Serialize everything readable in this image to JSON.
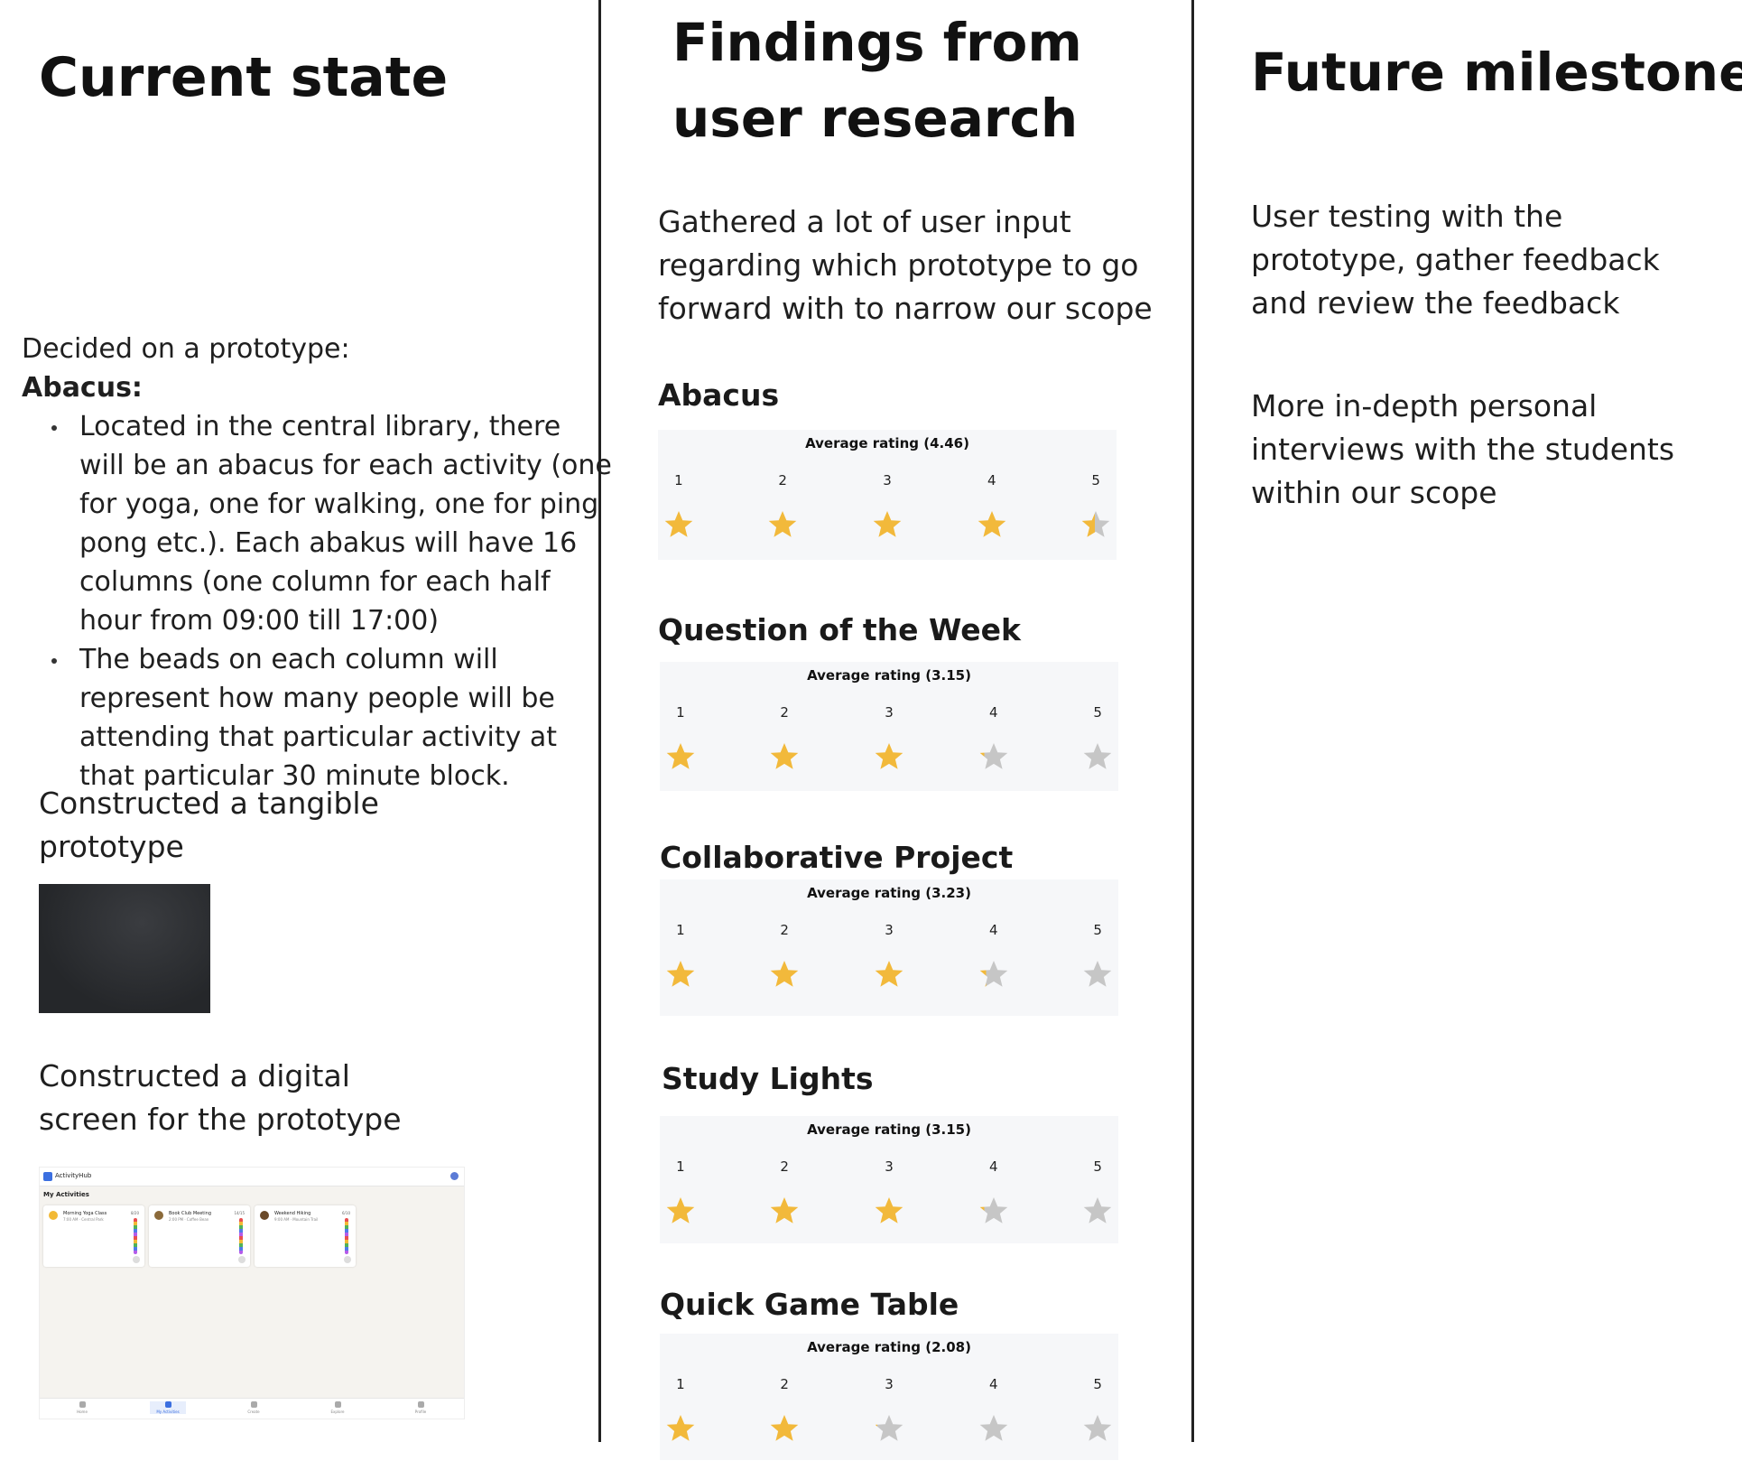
{
  "columns": {
    "current": {
      "title": "Current state",
      "decided": "Decided on a prototype:",
      "abacus_heading": "Abacus:",
      "bullets": [
        "Located in the central library, there will be an abacus for each activity (one for yoga, one for walking, one for ping pong etc.). Each abakus will have 16 columns (one column for each half hour from 09:00 till 17:00)",
        "The beads on each column will represent how many people will be attending that particular activity at that particular 30 minute block."
      ],
      "tangible": "Constructed a tangible prototype",
      "digital": "Constructed a digital screen for the prototype"
    },
    "findings": {
      "title": "Findings from user research",
      "intro": "Gathered a lot of user input regarding which prototype to go forward with to narrow our scope"
    },
    "future": {
      "title": "Future milestones",
      "items": [
        "User testing with the prototype, gather feedback and review the feedback",
        "More in-depth personal interviews with the students within our scope"
      ]
    }
  },
  "ratings": [
    {
      "name": "Abacus",
      "average_label": "Average rating (4.46)",
      "average": 4.46
    },
    {
      "name": "Question of the Week",
      "average_label": "Average rating (3.15)",
      "average": 3.15
    },
    {
      "name": "Collaborative Project",
      "average_label": "Average rating (3.23)",
      "average": 3.23
    },
    {
      "name": "Study Lights",
      "average_label": "Average rating (3.15)",
      "average": 3.15
    },
    {
      "name": "Quick Game Table",
      "average_label": "Average rating (2.08)",
      "average": 2.08
    }
  ],
  "scale_labels": [
    "1",
    "2",
    "3",
    "4",
    "5"
  ],
  "colors": {
    "star_filled": "#f2b93b",
    "star_empty": "#c6c6c6"
  },
  "screen_mock": {
    "app_name": "ActivityHub",
    "section": "My Activities",
    "cards": [
      {
        "title": "Morning Yoga Class",
        "sub": "7:00 AM · Central Park",
        "count": "8/20",
        "icon_color": "#f2b935"
      },
      {
        "title": "Book Club Meeting",
        "sub": "2:00 PM · Coffee Bean",
        "count": "14/15",
        "icon_color": "#8b6a3a"
      },
      {
        "title": "Weekend Hiking",
        "sub": "9:00 AM · Mountain Trail",
        "count": "6/10",
        "icon_color": "#6b4a2a"
      }
    ],
    "nav": [
      "Home",
      "My Activities",
      "Create",
      "Explore",
      "Profile"
    ]
  }
}
